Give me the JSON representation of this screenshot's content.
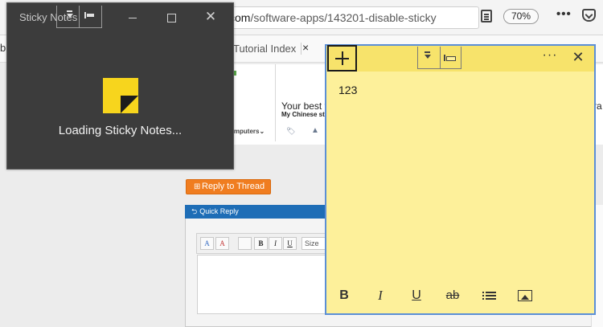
{
  "browser": {
    "url_host": "com",
    "url_path": "/software-apps/143201-disable-sticky",
    "zoom": "70%",
    "more_label": "•••",
    "bookmark_fragment": "b",
    "bookmark_tutorial": "Tutorial Index",
    "bookmark_close": "×"
  },
  "webpage": {
    "your_best_text": "Your best f",
    "chinese_link": "My Chinese stu",
    "computers_label": "omputers⌄",
    "right_fragment": "ra",
    "reply_button": "Reply to Thread",
    "quick_reply_title": "Quick Reply",
    "size_label": "Size",
    "editor_buttons": [
      "A",
      "A",
      "",
      "B",
      "I",
      "U"
    ]
  },
  "loader": {
    "title": "Sticky Notes",
    "close_glyph": "✕",
    "loading_text": "Loading Sticky Notes..."
  },
  "note": {
    "menu_glyph": "···",
    "close_glyph": "✕",
    "body_text": "123",
    "format": {
      "bold": "B",
      "italic": "I",
      "underline": "U",
      "strike": "ab"
    }
  }
}
